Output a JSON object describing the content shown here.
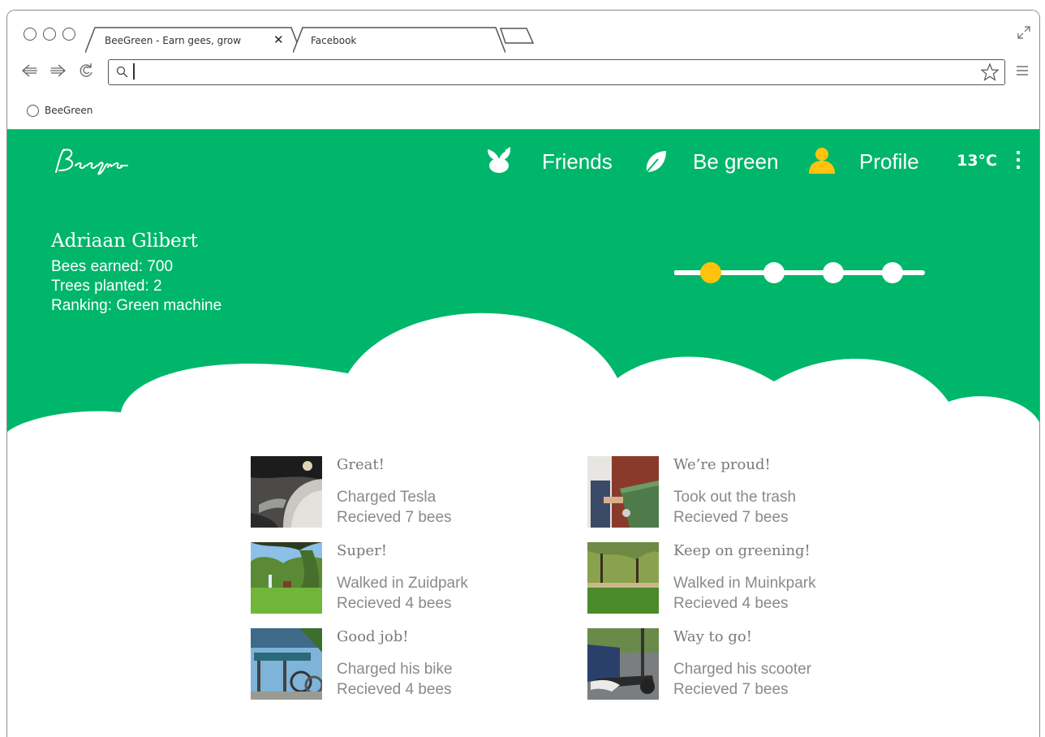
{
  "browser": {
    "tabs": [
      {
        "label": "BeeGreen - Earn gees, grow",
        "close": "✕"
      },
      {
        "label": "Facebook"
      }
    ],
    "url_value": "",
    "bookmarks": [
      {
        "label": "BeeGreen"
      }
    ]
  },
  "app": {
    "logo": "Beegreen",
    "nav": [
      {
        "label": "Friends",
        "icon": "bee-icon"
      },
      {
        "label": "Be green",
        "icon": "leaf-icon"
      },
      {
        "label": "Profile",
        "icon": "person-icon"
      }
    ],
    "temperature": "13°C",
    "accent_color": "#00b66b",
    "highlight_color": "#ffc20e"
  },
  "user": {
    "name": "Adriaan Glibert",
    "bees": "Bees earned: 700",
    "trees": "Trees planted: 2",
    "ranking": "Ranking: Green machine",
    "level_steps": 4,
    "current_level": 1
  },
  "feed": [
    {
      "title": "Great!",
      "action": "Charged Tesla",
      "reward": "Recieved 7 bees",
      "thumb": "car-charging-photo"
    },
    {
      "title": "We’re proud!",
      "action": "Took out the trash",
      "reward": "Recieved 7 bees",
      "thumb": "trash-bin-photo"
    },
    {
      "title": "Super!",
      "action": "Walked in Zuidpark",
      "reward": "Recieved 4 bees",
      "thumb": "park-fountain-photo"
    },
    {
      "title": "Keep on greening!",
      "action": "Walked in Muinkpark",
      "reward": "Recieved 4 bees",
      "thumb": "park-lawn-photo"
    },
    {
      "title": "Good job!",
      "action": "Charged his bike",
      "reward": "Recieved 4 bees",
      "thumb": "bike-station-photo"
    },
    {
      "title": "Way to go!",
      "action": "Charged his scooter",
      "reward": "Recieved 7 bees",
      "thumb": "scooter-photo"
    }
  ]
}
